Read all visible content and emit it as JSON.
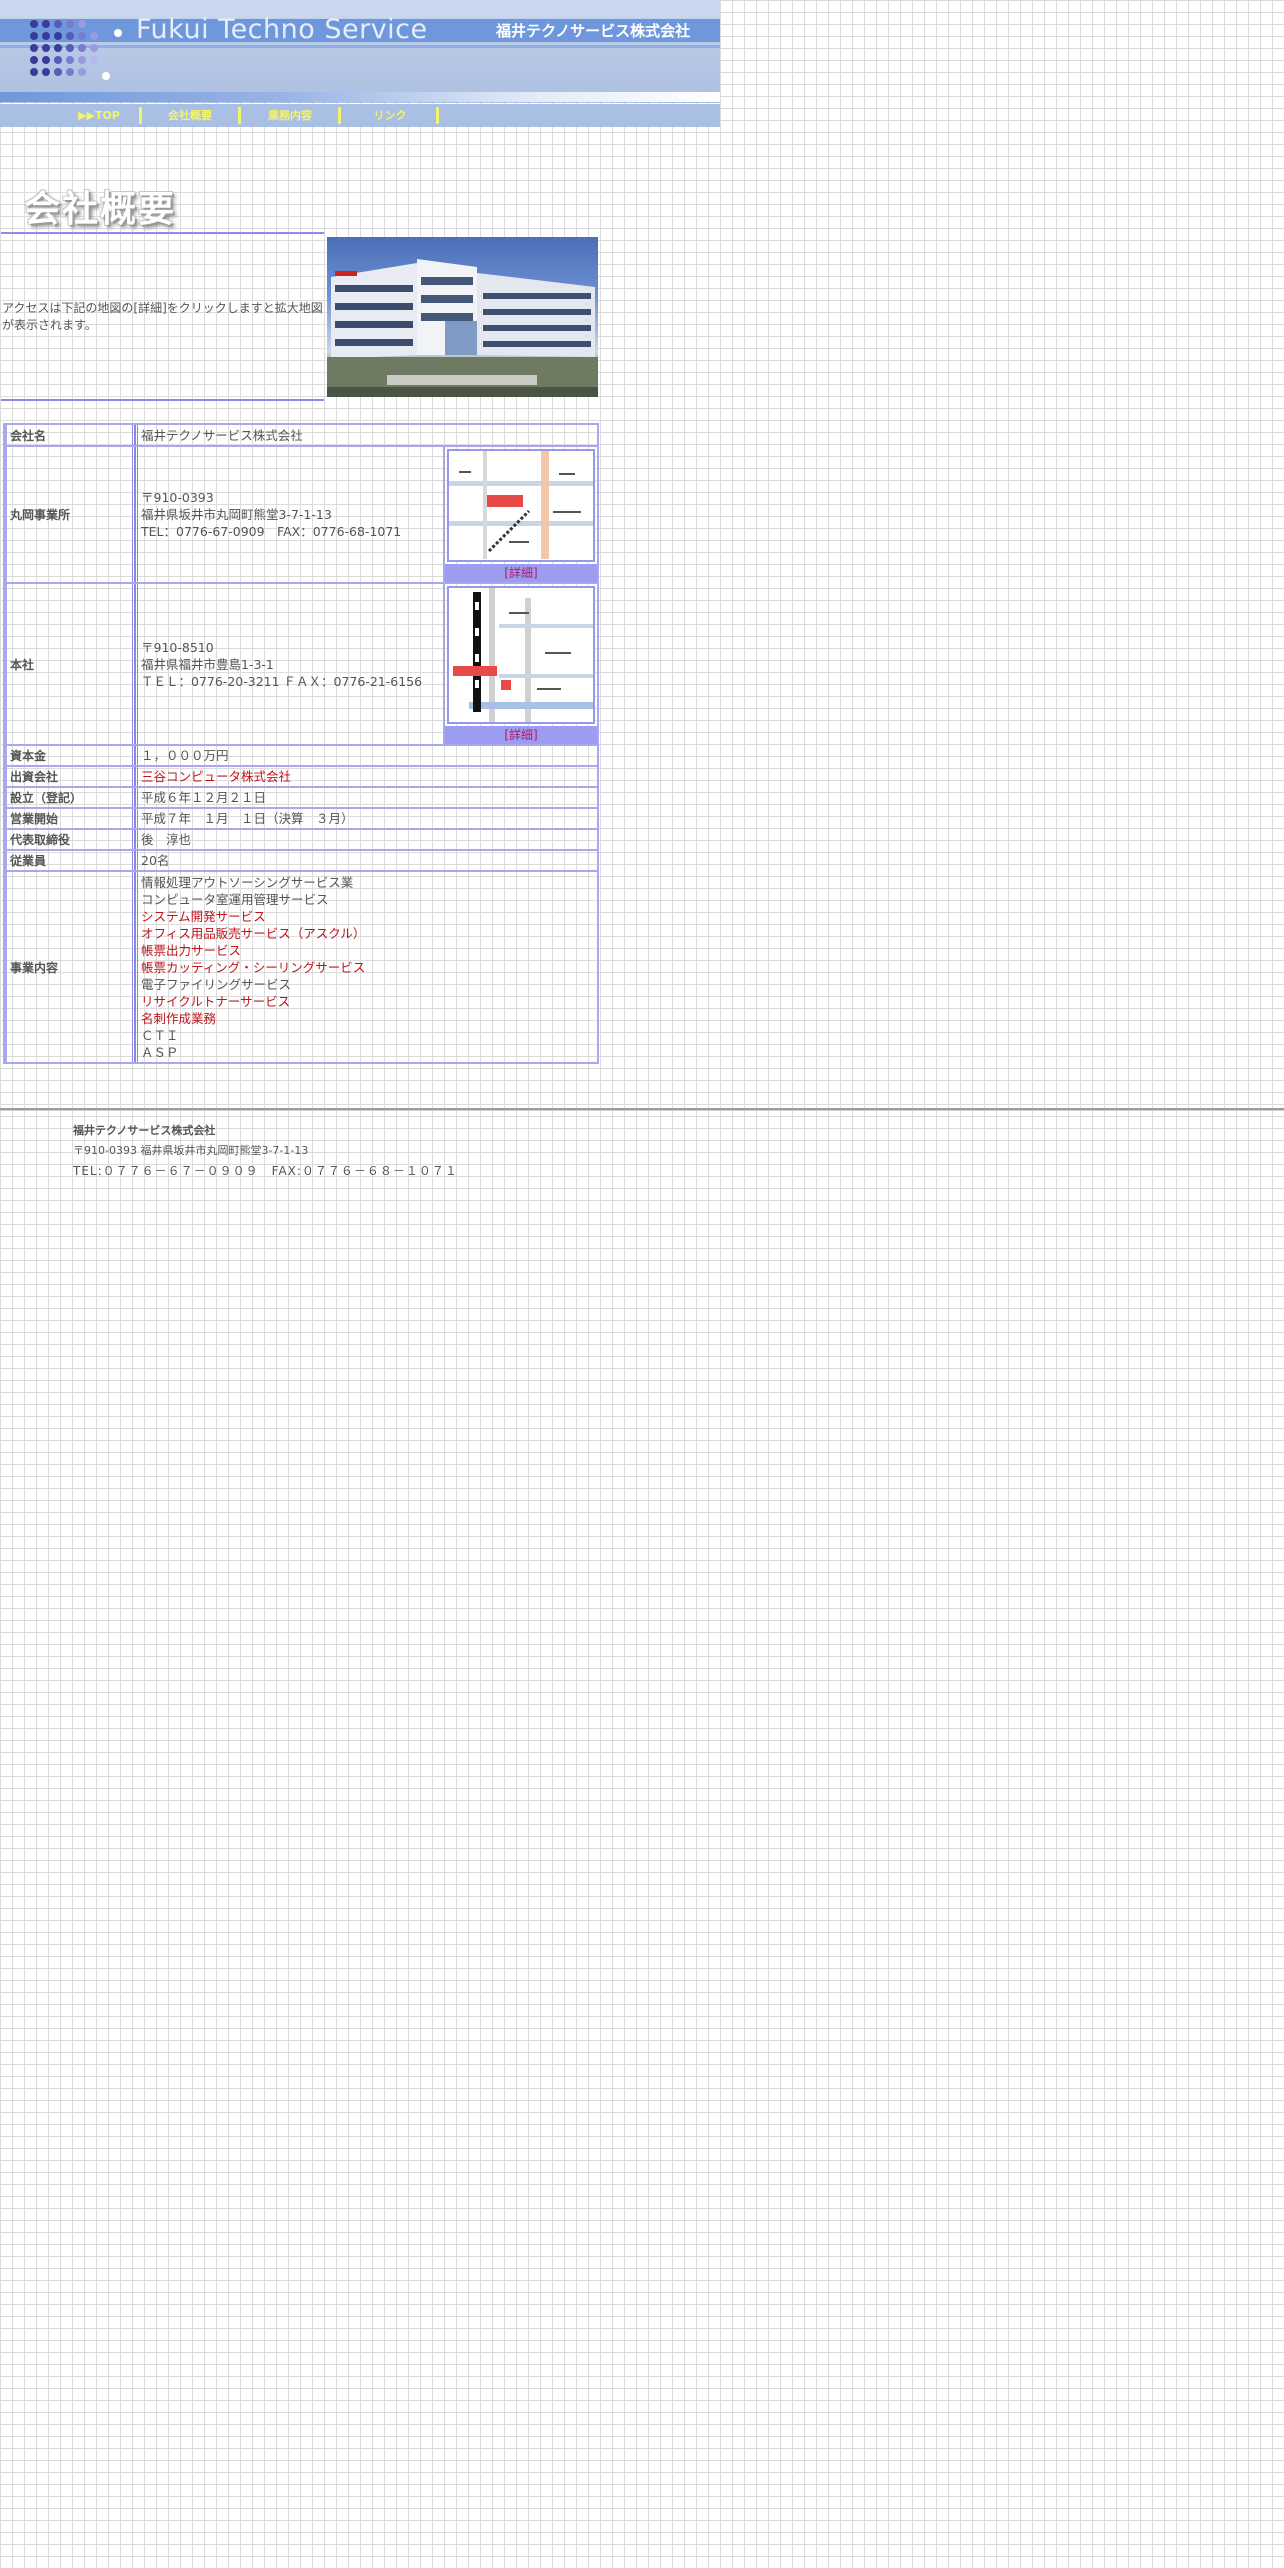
{
  "header": {
    "site_title": "Fukui Techno Service",
    "company_name": "福井テクノサービス株式会社"
  },
  "nav": {
    "items": [
      {
        "label": "▶▶TOP"
      },
      {
        "label": "会社概要"
      },
      {
        "label": "業務内容"
      },
      {
        "label": "リンク"
      }
    ]
  },
  "page_heading": "会社概要",
  "intro": "アクセスは下記の地図の[詳細]をクリックしますと拡大地図が表示されます。",
  "table": {
    "company_label": "会社名",
    "company_value": "福井テクノサービス株式会社",
    "maruoka": {
      "label": "丸岡事業所",
      "postal": "〒910-0393",
      "address": "福井県坂井市丸岡町熊堂3-7-1-13",
      "tel": "TEL：0776-67-0909　FAX：0776-68-1071",
      "map_link": "[詳細]"
    },
    "honsha": {
      "label": "本社",
      "postal": "〒910-8510",
      "address": "福井県福井市豊島1-3-1",
      "tel": "ＴＥＬ：0776-20-3211 ＦＡＸ：0776-21-6156",
      "map_link": "[詳細]"
    },
    "capital_label": "資本金",
    "capital_value": "１，０００万円",
    "parent_label": "出資会社",
    "parent_value": "三谷コンピュータ株式会社",
    "founded_label": "設立（登記）",
    "founded_value": "平成６年１２月２１日",
    "start_label": "営業開始",
    "start_value": "平成７年　１月　１日（決算　３月）",
    "rep_label": "代表取締役",
    "rep_value": "後　淳也",
    "staff_label": "従業員",
    "staff_value": "20名",
    "business_label": "事業内容",
    "business_items": [
      {
        "text": "情報処理アウトソーシングサービス業",
        "link": false
      },
      {
        "text": "コンピュータ室運用管理サービス",
        "link": false
      },
      {
        "text": "システム開発サービス",
        "link": true
      },
      {
        "text": "オフィス用品販売サービス（アスクル）",
        "link": true
      },
      {
        "text": "帳票出力サービス",
        "link": true
      },
      {
        "text": "帳票カッティング・シーリングサービス",
        "link": true
      },
      {
        "text": "電子ファイリングサービス",
        "link": false
      },
      {
        "text": "リサイクルトナーサービス",
        "link": true
      },
      {
        "text": "名刺作成業務",
        "link": true
      },
      {
        "text": "ＣＴＩ",
        "link": false
      },
      {
        "text": "ＡＳＰ",
        "link": false
      }
    ]
  },
  "footer": {
    "name": "福井テクノサービス株式会社",
    "address": "〒910-0393 福井県坂井市丸岡町熊堂3-7-1-13",
    "tel": "TEL:０７７６－６７－０９０９　FAX:０７７６－６８－１０７１"
  },
  "colors": {
    "nav_text": "#f4f46a",
    "table_border": "#a8a8ee",
    "link_red": "#c0141a",
    "banner_blue": "#6f97db"
  }
}
